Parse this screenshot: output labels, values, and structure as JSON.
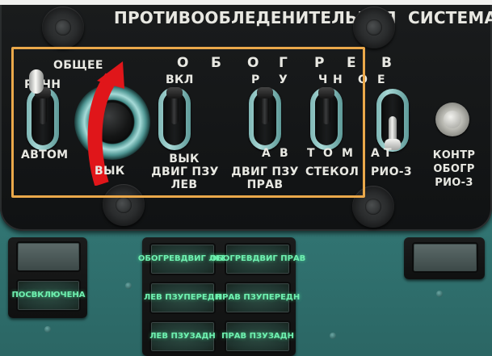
{
  "panel": {
    "title_left": "ПРОТИВООБЛЕДЕНИТЕЛЬНАЯ",
    "title_right": "СИСТЕМА",
    "obschee": "ОБЩЕЕ",
    "ruchn": "РУЧН",
    "avtom": "АВТОМ",
    "vyk_center": "ВЫК",
    "obogrev_spaced": [
      "О",
      "Б",
      "О",
      "Г",
      "Р",
      "Е",
      "В"
    ],
    "vkl": "ВКЛ",
    "ruchnoe_spaced": [
      "Р",
      "У",
      "Ч",
      "Н",
      "О",
      "Е"
    ],
    "avtom_spaced": [
      "А",
      "В",
      "Т",
      "О",
      "М",
      "А",
      "Т"
    ],
    "vyk_dvig_pzu_lev": [
      "ВЫК",
      "ДВИГ ПЗУ",
      "ЛЕВ"
    ],
    "dvig_pzu_prav": [
      "ДВИГ ПЗУ",
      "ПРАВ"
    ],
    "stekol": "СТЕКОЛ",
    "rio3": "РИО-3",
    "kontr_obogr_rio3": [
      "КОНТР",
      "ОБОГР",
      "РИО-3"
    ]
  },
  "switches": [
    {
      "id": "obschee",
      "position": "ruchn"
    },
    {
      "id": "dvig-pzu-lev",
      "position": "vkl"
    },
    {
      "id": "dvig-pzu-prav",
      "position": "vkl"
    },
    {
      "id": "stekol",
      "position": "ruchnoe"
    },
    {
      "id": "rio3",
      "position": "avtomat"
    }
  ],
  "indicators": {
    "left_top": "",
    "pos_vklyuchena": [
      "ПОС",
      "ВКЛЮЧЕНА"
    ],
    "obogrev_dvig_lev": [
      "ОБОГРЕВ",
      "ДВИГ ЛЕВ"
    ],
    "obogrev_dvig_prav": [
      "ОБОГРЕВ",
      "ДВИГ ПРАВ"
    ],
    "lev_pzu_peredn": [
      "ЛЕВ ПЗУ",
      "ПЕРЕДН"
    ],
    "prav_pzu_peredn": [
      "ПРАВ ПЗУ",
      "ПЕРЕДН"
    ],
    "lev_pzu_zadn": [
      "ЛЕВ ПЗУ",
      "ЗАДН"
    ],
    "prav_pzu_zadn": [
      "ПРАВ ПЗУ",
      "ЗАДН"
    ],
    "right_top": ""
  },
  "colors": {
    "highlight_box": "#eaa84a",
    "arrow": "#e0161a",
    "lamp_lit_text": "#6ff0b0",
    "panel_bg": "#121415",
    "bulkhead": "#2f6f6d"
  },
  "icons": {
    "arrow": "curved-arrow-icon",
    "screw": "screw-icon"
  }
}
